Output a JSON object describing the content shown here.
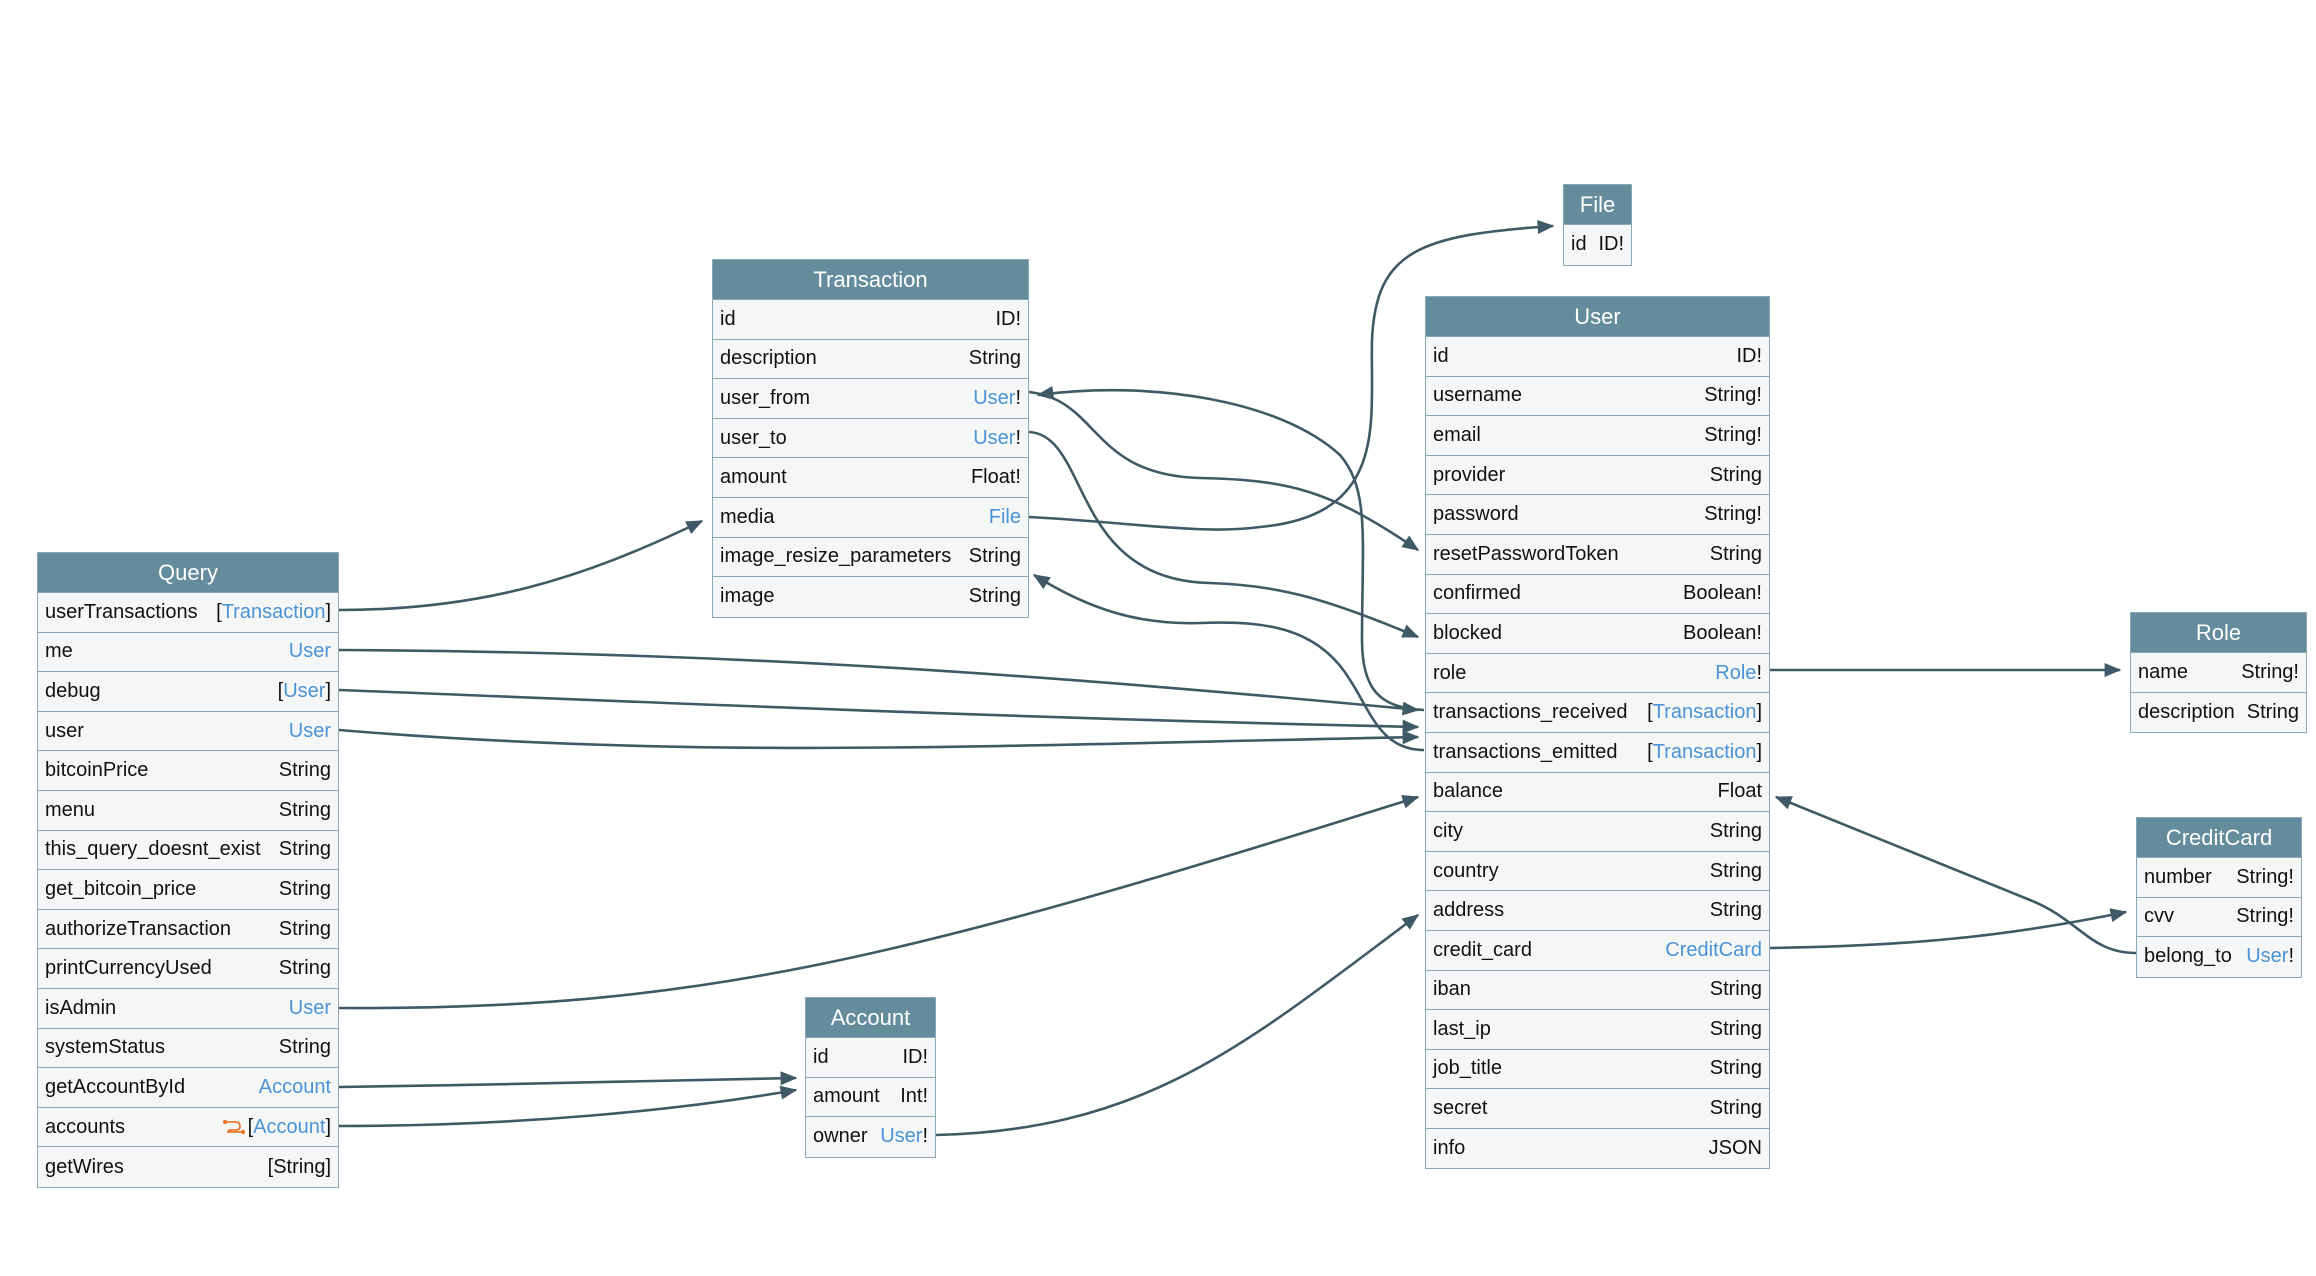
{
  "colors": {
    "header_bg": "#648c9c",
    "row_bg": "#f5f7f7",
    "border": "#8aa8b6",
    "type_link": "#4a93d4",
    "edge": "#3f5a66",
    "relay_icon": "#e8792e"
  },
  "nodes": {
    "query": {
      "title": "Query",
      "fields": [
        {
          "name": "userTransactions",
          "pre": "[",
          "type": "Transaction",
          "post": "]",
          "link": true
        },
        {
          "name": "me",
          "pre": "",
          "type": "User",
          "post": "",
          "link": true
        },
        {
          "name": "debug",
          "pre": "[",
          "type": "User",
          "post": "]",
          "link": true
        },
        {
          "name": "user",
          "pre": "",
          "type": "User",
          "post": "",
          "link": true
        },
        {
          "name": "bitcoinPrice",
          "pre": "",
          "type": "String",
          "post": "",
          "link": false
        },
        {
          "name": "menu",
          "pre": "",
          "type": "String",
          "post": "",
          "link": false
        },
        {
          "name": "this_query_doesnt_exist",
          "pre": "",
          "type": "String",
          "post": "",
          "link": false
        },
        {
          "name": "get_bitcoin_price",
          "pre": "",
          "type": "String",
          "post": "",
          "link": false
        },
        {
          "name": "authorizeTransaction",
          "pre": "",
          "type": "String",
          "post": "",
          "link": false
        },
        {
          "name": "printCurrencyUsed",
          "pre": "",
          "type": "String",
          "post": "",
          "link": false
        },
        {
          "name": "isAdmin",
          "pre": "",
          "type": "User",
          "post": "",
          "link": true
        },
        {
          "name": "systemStatus",
          "pre": "",
          "type": "String",
          "post": "",
          "link": false
        },
        {
          "name": "getAccountById",
          "pre": "",
          "type": "Account",
          "post": "",
          "link": true
        },
        {
          "name": "accounts",
          "pre": "[",
          "type": "Account",
          "post": "]",
          "link": true,
          "icon": "relay-connection-icon"
        },
        {
          "name": "getWires",
          "pre": "",
          "type": "[String]",
          "post": "",
          "link": false
        }
      ]
    },
    "transaction": {
      "title": "Transaction",
      "fields": [
        {
          "name": "id",
          "pre": "",
          "type": "ID!",
          "post": "",
          "link": false
        },
        {
          "name": "description",
          "pre": "",
          "type": "String",
          "post": "",
          "link": false
        },
        {
          "name": "user_from",
          "pre": "",
          "type": "User",
          "post": "!",
          "link": true
        },
        {
          "name": "user_to",
          "pre": "",
          "type": "User",
          "post": "!",
          "link": true
        },
        {
          "name": "amount",
          "pre": "",
          "type": "Float!",
          "post": "",
          "link": false
        },
        {
          "name": "media",
          "pre": "",
          "type": "File",
          "post": "",
          "link": true
        },
        {
          "name": "image_resize_parameters",
          "pre": "",
          "type": "String",
          "post": "",
          "link": false
        },
        {
          "name": "image",
          "pre": "",
          "type": "String",
          "post": "",
          "link": false
        }
      ]
    },
    "file": {
      "title": "File",
      "fields": [
        {
          "name": "id",
          "pre": "",
          "type": "ID!",
          "post": "",
          "link": false
        }
      ]
    },
    "user": {
      "title": "User",
      "fields": [
        {
          "name": "id",
          "pre": "",
          "type": "ID!",
          "post": "",
          "link": false
        },
        {
          "name": "username",
          "pre": "",
          "type": "String!",
          "post": "",
          "link": false
        },
        {
          "name": "email",
          "pre": "",
          "type": "String!",
          "post": "",
          "link": false
        },
        {
          "name": "provider",
          "pre": "",
          "type": "String",
          "post": "",
          "link": false
        },
        {
          "name": "password",
          "pre": "",
          "type": "String!",
          "post": "",
          "link": false
        },
        {
          "name": "resetPasswordToken",
          "pre": "",
          "type": "String",
          "post": "",
          "link": false
        },
        {
          "name": "confirmed",
          "pre": "",
          "type": "Boolean!",
          "post": "",
          "link": false
        },
        {
          "name": "blocked",
          "pre": "",
          "type": "Boolean!",
          "post": "",
          "link": false
        },
        {
          "name": "role",
          "pre": "",
          "type": "Role",
          "post": "!",
          "link": true
        },
        {
          "name": "transactions_received",
          "pre": "[",
          "type": "Transaction",
          "post": "]",
          "link": true
        },
        {
          "name": "transactions_emitted",
          "pre": "[",
          "type": "Transaction",
          "post": "]",
          "link": true
        },
        {
          "name": "balance",
          "pre": "",
          "type": "Float",
          "post": "",
          "link": false
        },
        {
          "name": "city",
          "pre": "",
          "type": "String",
          "post": "",
          "link": false
        },
        {
          "name": "country",
          "pre": "",
          "type": "String",
          "post": "",
          "link": false
        },
        {
          "name": "address",
          "pre": "",
          "type": "String",
          "post": "",
          "link": false
        },
        {
          "name": "credit_card",
          "pre": "",
          "type": "CreditCard",
          "post": "",
          "link": true
        },
        {
          "name": "iban",
          "pre": "",
          "type": "String",
          "post": "",
          "link": false
        },
        {
          "name": "last_ip",
          "pre": "",
          "type": "String",
          "post": "",
          "link": false
        },
        {
          "name": "job_title",
          "pre": "",
          "type": "String",
          "post": "",
          "link": false
        },
        {
          "name": "secret",
          "pre": "",
          "type": "String",
          "post": "",
          "link": false
        },
        {
          "name": "info",
          "pre": "",
          "type": "JSON",
          "post": "",
          "link": false
        }
      ]
    },
    "role": {
      "title": "Role",
      "fields": [
        {
          "name": "name",
          "pre": "",
          "type": "String!",
          "post": "",
          "link": false
        },
        {
          "name": "description",
          "pre": "",
          "type": "String",
          "post": "",
          "link": false
        }
      ]
    },
    "creditcard": {
      "title": "CreditCard",
      "fields": [
        {
          "name": "number",
          "pre": "",
          "type": "String!",
          "post": "",
          "link": false
        },
        {
          "name": "cvv",
          "pre": "",
          "type": "String!",
          "post": "",
          "link": false
        },
        {
          "name": "belong_to",
          "pre": "",
          "type": "User",
          "post": "!",
          "link": true
        }
      ]
    },
    "account": {
      "title": "Account",
      "fields": [
        {
          "name": "id",
          "pre": "",
          "type": "ID!",
          "post": "",
          "link": false
        },
        {
          "name": "amount",
          "pre": "",
          "type": "Int!",
          "post": "",
          "link": false
        },
        {
          "name": "owner",
          "pre": "",
          "type": "User",
          "post": "!",
          "link": true
        }
      ]
    }
  },
  "edges": [
    {
      "from": "Query.userTransactions",
      "to": "Transaction"
    },
    {
      "from": "Query.me",
      "to": "User"
    },
    {
      "from": "Query.debug",
      "to": "User"
    },
    {
      "from": "Query.user",
      "to": "User"
    },
    {
      "from": "Query.isAdmin",
      "to": "User"
    },
    {
      "from": "Query.getAccountById",
      "to": "Account"
    },
    {
      "from": "Query.accounts",
      "to": "Account"
    },
    {
      "from": "Transaction.user_from",
      "to": "User"
    },
    {
      "from": "Transaction.user_to",
      "to": "User"
    },
    {
      "from": "Transaction.media",
      "to": "File"
    },
    {
      "from": "User.role",
      "to": "Role"
    },
    {
      "from": "User.transactions_received",
      "to": "Transaction"
    },
    {
      "from": "User.transactions_emitted",
      "to": "Transaction"
    },
    {
      "from": "User.credit_card",
      "to": "CreditCard"
    },
    {
      "from": "CreditCard.belong_to",
      "to": "User"
    },
    {
      "from": "Account.owner",
      "to": "User"
    }
  ]
}
